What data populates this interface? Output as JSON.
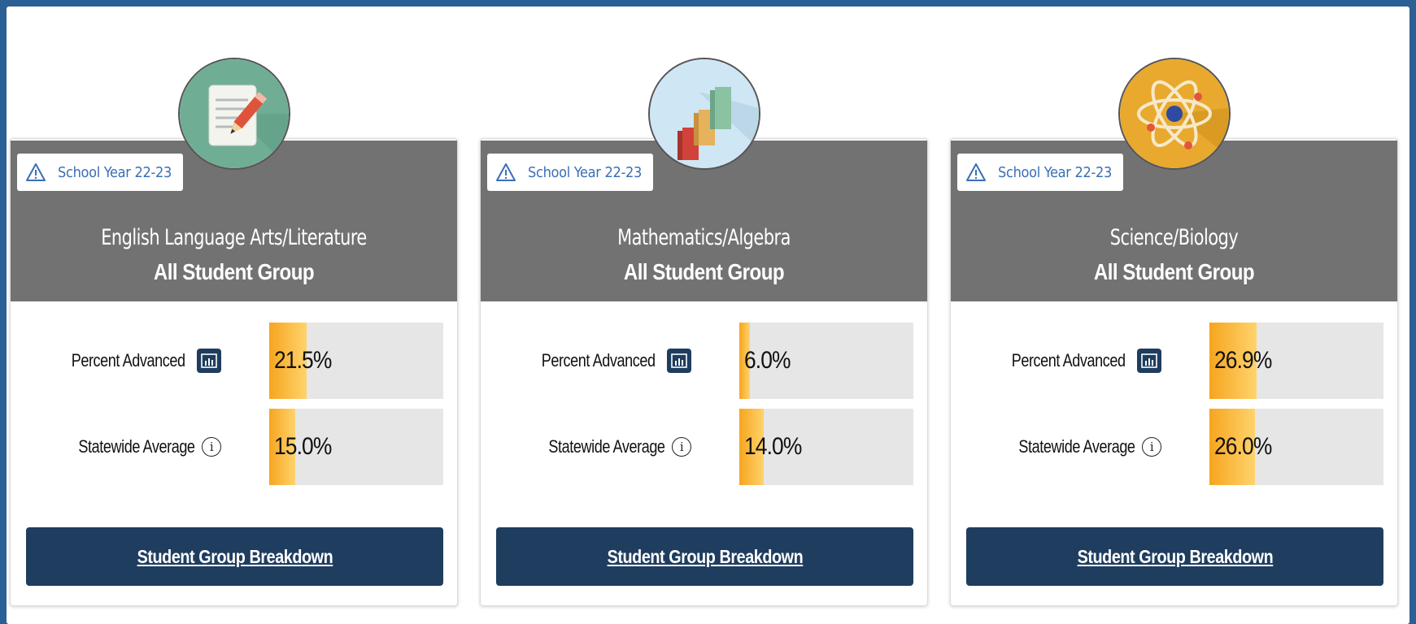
{
  "cards": [
    {
      "school_year": "School Year 22-23",
      "subject": "English Language Arts/Literature",
      "group": "All Student Group",
      "icon": "document-pencil-icon",
      "icon_bg": "#6fae95",
      "metrics": {
        "percent_advanced": {
          "label": "Percent Advanced",
          "value": "21.5%",
          "fraction": 0.215
        },
        "statewide_average": {
          "label": "Statewide Average",
          "value": "15.0%",
          "fraction": 0.15
        }
      },
      "breakdown_label": "Student Group Breakdown"
    },
    {
      "school_year": "School Year 22-23",
      "subject": "Mathematics/Algebra",
      "group": "All Student Group",
      "icon": "bar-blocks-icon",
      "icon_bg": "#cfe6f4",
      "metrics": {
        "percent_advanced": {
          "label": "Percent Advanced",
          "value": "6.0%",
          "fraction": 0.06
        },
        "statewide_average": {
          "label": "Statewide Average",
          "value": "14.0%",
          "fraction": 0.14
        }
      },
      "breakdown_label": "Student Group Breakdown"
    },
    {
      "school_year": "School Year 22-23",
      "subject": "Science/Biology",
      "group": "All Student Group",
      "icon": "atom-icon",
      "icon_bg": "#e8a92e",
      "metrics": {
        "percent_advanced": {
          "label": "Percent Advanced",
          "value": "26.9%",
          "fraction": 0.269
        },
        "statewide_average": {
          "label": "Statewide Average",
          "value": "26.0%",
          "fraction": 0.26
        }
      },
      "breakdown_label": "Student Group Breakdown"
    }
  ],
  "colors": {
    "page_border": "#2c5f93",
    "header_gray": "#727272",
    "navy": "#1f3d5f",
    "bar_orange": "#f6a51f",
    "bar_track": "#e6e6e6",
    "year_blue": "#3b6fb6"
  }
}
